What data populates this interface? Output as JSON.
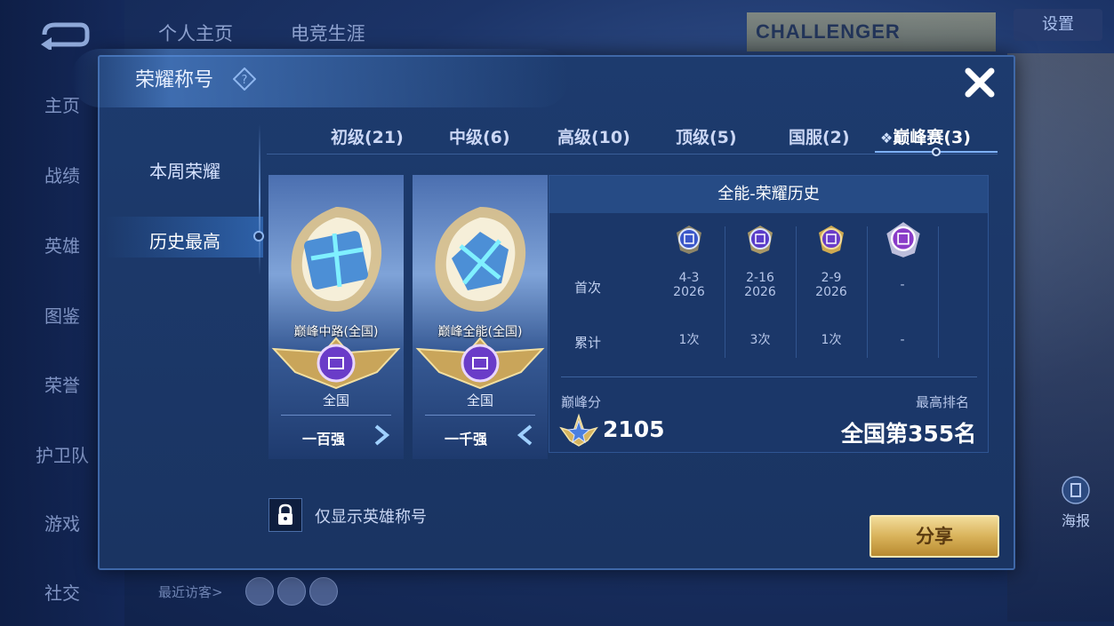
{
  "background": {
    "nav_items": [
      "主页",
      "战绩",
      "英雄",
      "图鉴",
      "荣誉",
      "护卫队",
      "游戏",
      "社交"
    ],
    "top_tabs": [
      "个人主页",
      "电竞生涯"
    ],
    "challenge_text": "CHALLENGER",
    "settings_label": "设置",
    "poster_label": "海报",
    "visitor_label": "最近访客>"
  },
  "dialog": {
    "title": "荣耀称号",
    "side_menu": [
      "本周荣耀",
      "历史最高"
    ],
    "active_side": "历史最高",
    "tabs": [
      {
        "label": "初级(21)"
      },
      {
        "label": "中级(6)"
      },
      {
        "label": "高级(10)"
      },
      {
        "label": "顶级(5)"
      },
      {
        "label": "国服(2)"
      },
      {
        "label": "巅峰赛(3)",
        "active": true
      }
    ],
    "cards": [
      {
        "title": "巅峰中路(全国)",
        "region": "全国",
        "rank": "一百强"
      },
      {
        "title": "巅峰全能(全国)",
        "region": "全国",
        "rank": "一千强"
      }
    ],
    "history": {
      "header": "全能-荣耀历史",
      "row_labels": [
        "首次",
        "累计"
      ],
      "first": [
        [
          "4-3",
          "2026"
        ],
        [
          "2-16",
          "2026"
        ],
        [
          "2-9",
          "2026"
        ],
        [
          "-",
          ""
        ]
      ],
      "total": [
        "1次",
        "3次",
        "1次",
        "-"
      ],
      "peak_label": "巅峰分",
      "peak_score": "2105",
      "best_label": "最高排名",
      "best_rank": "全国第355名"
    },
    "lock_label": "仅显示英雄称号",
    "share_label": "分享"
  },
  "colors": {
    "accent": "#3f68a8",
    "share_gold": "#d9b35b",
    "panel": "#1b3769"
  }
}
